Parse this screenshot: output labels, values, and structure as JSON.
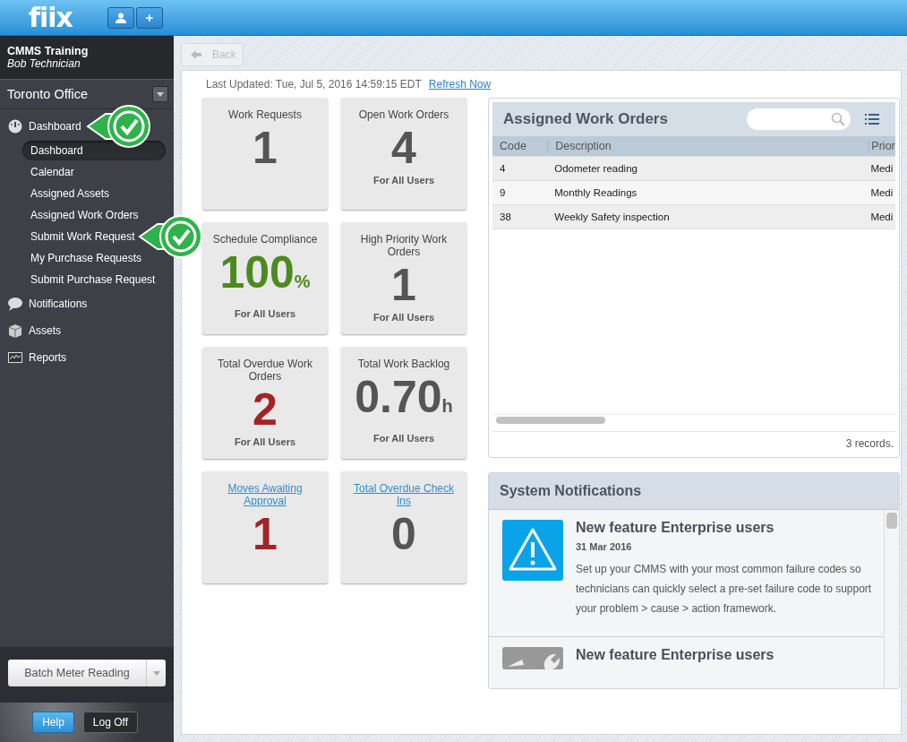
{
  "header": {
    "logo": "fiix",
    "buttons": [
      {
        "kind": "user"
      },
      {
        "kind": "add",
        "label": "+"
      }
    ]
  },
  "sidebar": {
    "site": "CMMS Training",
    "user": "Bob Technician",
    "location": "Toronto Office",
    "nav": [
      {
        "label": "Dashboard",
        "kind": "gauge",
        "callout": true,
        "children": [
          {
            "label": "Dashboard",
            "selected": true,
            "callout": false
          },
          {
            "label": "Calendar",
            "selected": false,
            "callout": false
          },
          {
            "label": "Assigned Assets",
            "selected": false,
            "callout": false
          },
          {
            "label": "Assigned Work Orders",
            "selected": false,
            "callout": false
          },
          {
            "label": "Submit Work Request",
            "selected": false,
            "callout": true
          },
          {
            "label": "My Purchase Requests",
            "selected": false,
            "callout": false
          },
          {
            "label": "Submit Purchase Request",
            "selected": false,
            "callout": false
          }
        ]
      },
      {
        "label": "Notifications",
        "kind": "bubble",
        "callout": false
      },
      {
        "label": "Assets",
        "kind": "box",
        "callout": false
      },
      {
        "label": "Reports",
        "kind": "chart",
        "callout": false
      }
    ],
    "batch_button": "Batch Meter Reading",
    "help": "Help",
    "logoff": "Log Off"
  },
  "toolbar": {
    "back": "Back",
    "back_disabled": true
  },
  "last_updated": "Last Updated: Tue, Jul 5, 2016 14:59:15 EDT",
  "refresh": "Refresh Now",
  "tiles": [
    {
      "title": "Work Requests",
      "link": false,
      "value": "1",
      "color": "#555555"
    },
    {
      "title": "Open Work Orders",
      "link": false,
      "value": "4",
      "color": "#555555",
      "footer": "For All Users"
    },
    {
      "title": "Schedule Compliance",
      "link": false,
      "value": "100",
      "unit": "%",
      "color": "#4d8a1e",
      "footer": "For All Users"
    },
    {
      "title": "High Priority Work Orders",
      "link": false,
      "value": "1",
      "color": "#555555",
      "footer": "For All Users"
    },
    {
      "title": "Total Overdue Work Orders",
      "link": false,
      "value": "2",
      "color": "#a52226",
      "footer": "For All Users"
    },
    {
      "title": "Total Work Backlog",
      "link": false,
      "value": "0.70",
      "unit": "h",
      "color": "#555555",
      "footer": "For All Users"
    },
    {
      "title": "Moves Awaiting Approval",
      "link": true,
      "value": "1",
      "color": "#a52226"
    },
    {
      "title": "Total Overdue Check Ins",
      "link": true,
      "value": "0",
      "color": "#555555"
    }
  ],
  "work_orders": {
    "title": "Assigned Work Orders",
    "columns": [
      "Code",
      "Description",
      "Prior"
    ],
    "rows": [
      [
        "4",
        "Odometer reading",
        "Medi"
      ],
      [
        "9",
        "Monthly Readings",
        "Medi"
      ],
      [
        "38",
        "Weekly Safety inspection",
        "Medi"
      ]
    ],
    "footer": "3 records."
  },
  "notifications": {
    "title": "System Notifications",
    "items": [
      {
        "kind": "warning",
        "title": "New feature Enterprise users",
        "date": "31 Mar 2016",
        "body": "Set up your CMMS with your most common failure codes so technicians can quickly select a pre-set failure code to support your problem > cause > action framework."
      },
      {
        "kind": "tools",
        "title": "New feature Enterprise users"
      }
    ]
  }
}
